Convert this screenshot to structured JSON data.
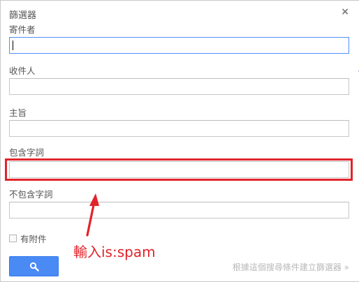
{
  "dialog": {
    "title": "篩選器",
    "close_glyph": "×"
  },
  "fields": {
    "from_label": "寄件者",
    "to_label": "收件人",
    "subject_label": "主旨",
    "has_words_label": "包含字詞",
    "not_words_label": "不包含字詞",
    "from_value": "",
    "to_value": "",
    "subject_value": "",
    "has_words_value": "",
    "not_words_value": ""
  },
  "attachment": {
    "label": "有附件",
    "checked": false
  },
  "actions": {
    "search_icon": "magnifier-icon",
    "create_filter_label": "根據這個搜尋條件建立篩選器 »"
  },
  "annotation": {
    "text": "輸入is:spam",
    "color": "#e2232a"
  },
  "colors": {
    "button_blue": "#4a8af4",
    "focus_border": "#4d90fe",
    "highlight_red": "#e2232a"
  }
}
